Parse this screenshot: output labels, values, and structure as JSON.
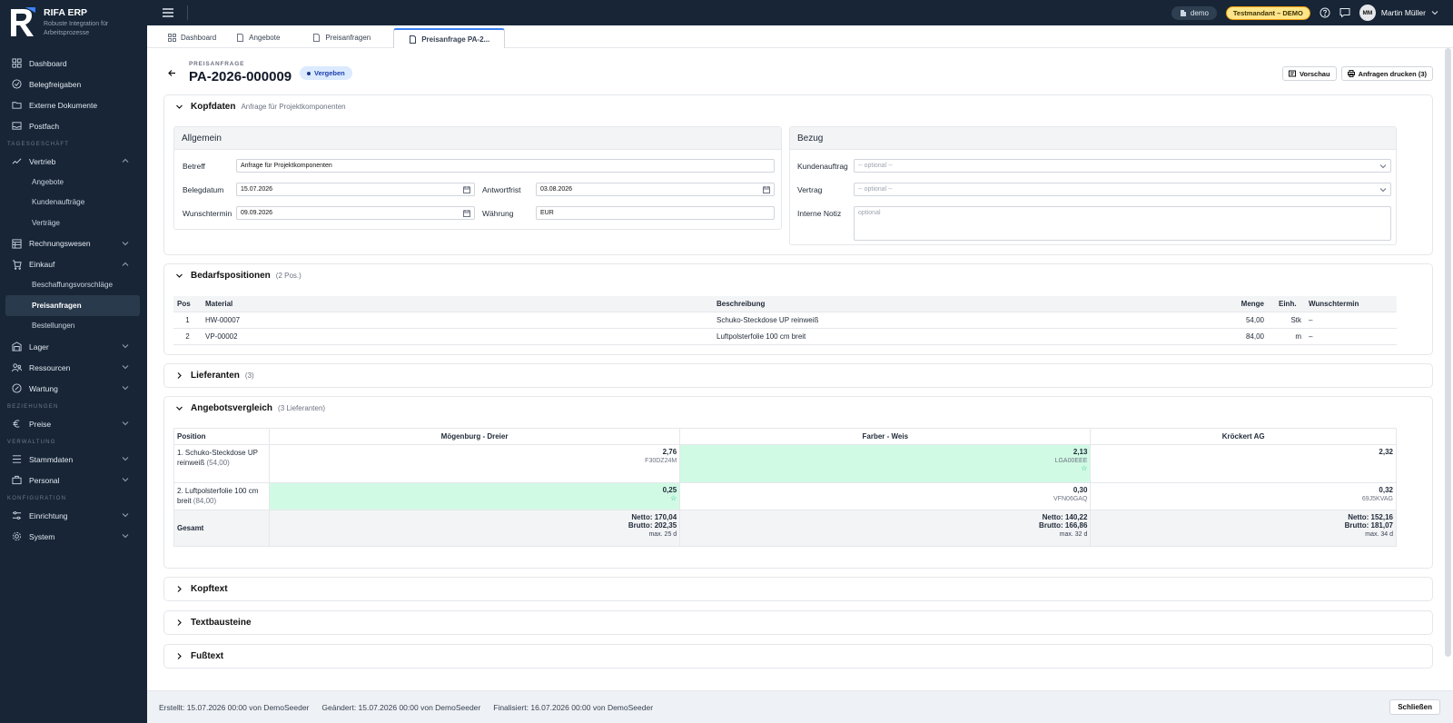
{
  "brand": {
    "name": "RIFA ERP",
    "subtitle": "Robuste Integration für Arbeitsprozesse"
  },
  "sidebar": {
    "top": [
      {
        "label": "Dashboard"
      },
      {
        "label": "Belegfreigaben"
      },
      {
        "label": "Externe Dokumente"
      },
      {
        "label": "Postfach"
      }
    ],
    "sec1": "TAGESGESCHÄFT",
    "vertrieb": "Vertrieb",
    "vertrieb_sub": [
      "Angebote",
      "Kundenaufträge",
      "Verträge"
    ],
    "rechnungswesen": "Rechnungswesen",
    "einkauf": "Einkauf",
    "einkauf_sub": [
      "Beschaffungsvorschläge",
      "Preisanfragen",
      "Bestellungen"
    ],
    "lager": "Lager",
    "ressourcen": "Ressourcen",
    "wartung": "Wartung",
    "sec2": "BEZIEHUNGEN",
    "preise": "Preise",
    "sec3": "VERWALTUNG",
    "stammdaten": "Stammdaten",
    "personal": "Personal",
    "sec4": "KONFIGURATION",
    "einrichtung": "Einrichtung",
    "system": "System"
  },
  "topbar": {
    "tenant": "demo",
    "badge": "Testmandant – DEMO",
    "user_initials": "MM",
    "user_name": "Martin Müller"
  },
  "tabs": [
    "Dashboard",
    "Angebote",
    "Preisanfragen",
    "Preisanfrage PA-2..."
  ],
  "header": {
    "doctype": "PREISANFRAGE",
    "docnum": "PA-2026-000009",
    "status": "Vergeben",
    "preview": "Vorschau",
    "print": "Anfragen drucken (3)"
  },
  "kopfdaten": {
    "title": "Kopfdaten",
    "subtitle": "Anfrage für Projektkomponenten",
    "allgemein": "Allgemein",
    "bezug": "Bezug",
    "betreff_label": "Betreff",
    "betreff": "Anfrage für Projektkomponenten",
    "belegdatum_label": "Belegdatum",
    "belegdatum": "15.07.2026",
    "antwortfrist_label": "Antwortfrist",
    "antwortfrist": "03.08.2026",
    "wunschtermin_label": "Wunschtermin",
    "wunschtermin": "09.09.2026",
    "waehrung_label": "Währung",
    "waehrung": "EUR",
    "kundenauftrag_label": "Kundenauftrag",
    "kundenauftrag_ph": "-- optional --",
    "vertrag_label": "Vertrag",
    "vertrag_ph": "-- optional --",
    "notiz_label": "Interne Notiz",
    "notiz_ph": "optional"
  },
  "bedarf": {
    "title": "Bedarfspositionen",
    "count": "(2 Pos.)",
    "cols": [
      "Pos",
      "Material",
      "Beschreibung",
      "Menge",
      "Einh.",
      "Wunschtermin"
    ],
    "rows": [
      {
        "pos": "1",
        "material": "HW-00007",
        "desc": "Schuko-Steckdose UP reinweiß",
        "menge": "54,00",
        "einh": "Stk",
        "termin": "–"
      },
      {
        "pos": "2",
        "material": "VP-00002",
        "desc": "Luftpolsterfolie 100 cm breit",
        "menge": "84,00",
        "einh": "m",
        "termin": "–"
      }
    ]
  },
  "lieferanten": {
    "title": "Lieferanten",
    "count": "(3)"
  },
  "vergleich": {
    "title": "Angebotsvergleich",
    "count": "(3 Lieferanten)",
    "col_position": "Position",
    "suppliers": [
      "Mögenburg - Dreier",
      "Farber - Weis",
      "Kröckert AG"
    ],
    "row1": {
      "name": "1. Schuko-Steckdose UP reinweiß",
      "qty": "(54,00)",
      "p1": "2,76",
      "c1": "F30DZ24M",
      "p2": "2,13",
      "c2": "LGA00EEE",
      "p3": "2,32",
      "star": "☆"
    },
    "row2": {
      "name": "2. Luftpolsterfolie 100 cm breit",
      "qty": "(84,00)",
      "p1": "0,25",
      "p2": "0,30",
      "c2": "VFN06GAQ",
      "p3": "0,32",
      "c3": "69J5KVAG",
      "star": "☆"
    },
    "total_label": "Gesamt",
    "totals": [
      {
        "netto": "Netto: 170,04",
        "brutto": "Brutto: 202,35",
        "max": "max. 25 d"
      },
      {
        "netto": "Netto: 140,22",
        "brutto": "Brutto: 166,86",
        "max": "max. 32 d"
      },
      {
        "netto": "Netto: 152,16",
        "brutto": "Brutto: 181,07",
        "max": "max. 34 d"
      }
    ]
  },
  "sections": {
    "kopftext": "Kopftext",
    "textbausteine": "Textbausteine",
    "fusstext": "Fußtext"
  },
  "footer": {
    "erstellt": "Erstellt: 15.07.2026 00:00 von DemoSeeder",
    "geaendert": "Geändert: 15.07.2026 00:00 von DemoSeeder",
    "finalisiert": "Finalisiert: 16.07.2026 00:00 von DemoSeeder",
    "close": "Schließen"
  }
}
